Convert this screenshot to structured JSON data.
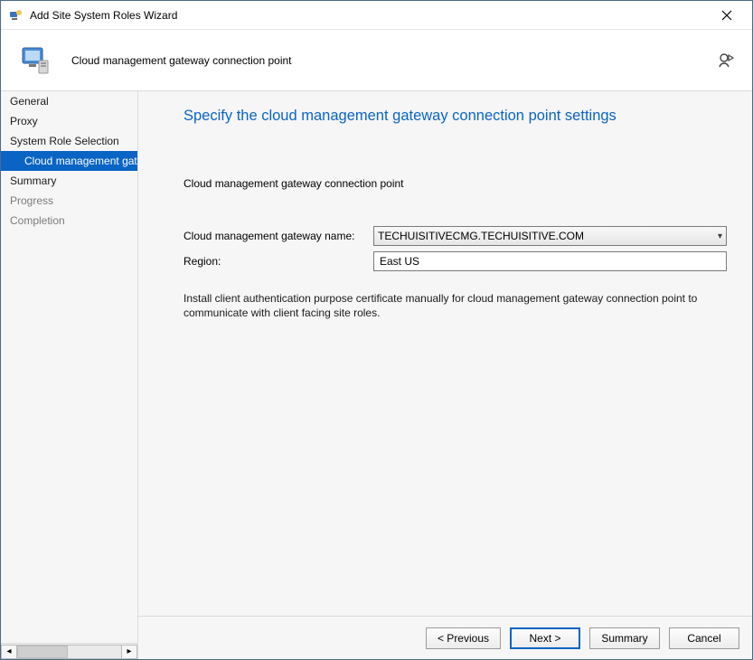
{
  "window": {
    "title": "Add Site System Roles Wizard"
  },
  "header": {
    "subtitle": "Cloud management gateway connection point"
  },
  "sidebar": {
    "items": [
      {
        "label": "General",
        "selected": false,
        "indent": false,
        "dim": false
      },
      {
        "label": "Proxy",
        "selected": false,
        "indent": false,
        "dim": false
      },
      {
        "label": "System Role Selection",
        "selected": false,
        "indent": false,
        "dim": false
      },
      {
        "label": "Cloud management gate",
        "selected": true,
        "indent": true,
        "dim": false
      },
      {
        "label": "Summary",
        "selected": false,
        "indent": false,
        "dim": false
      },
      {
        "label": "Progress",
        "selected": false,
        "indent": false,
        "dim": true
      },
      {
        "label": "Completion",
        "selected": false,
        "indent": false,
        "dim": true
      }
    ]
  },
  "page": {
    "title": "Specify the cloud management gateway connection point settings",
    "section_label": "Cloud management gateway connection point",
    "gateway_name_label": "Cloud management gateway name:",
    "gateway_name_value": "TECHUISITIVECMG.TECHUISITIVE.COM",
    "region_label": "Region:",
    "region_value": "East US",
    "note": "Install client authentication purpose certificate manually for cloud management gateway connection point to communicate with client facing site roles."
  },
  "footer": {
    "previous": "< Previous",
    "next": "Next >",
    "summary": "Summary",
    "cancel": "Cancel"
  }
}
